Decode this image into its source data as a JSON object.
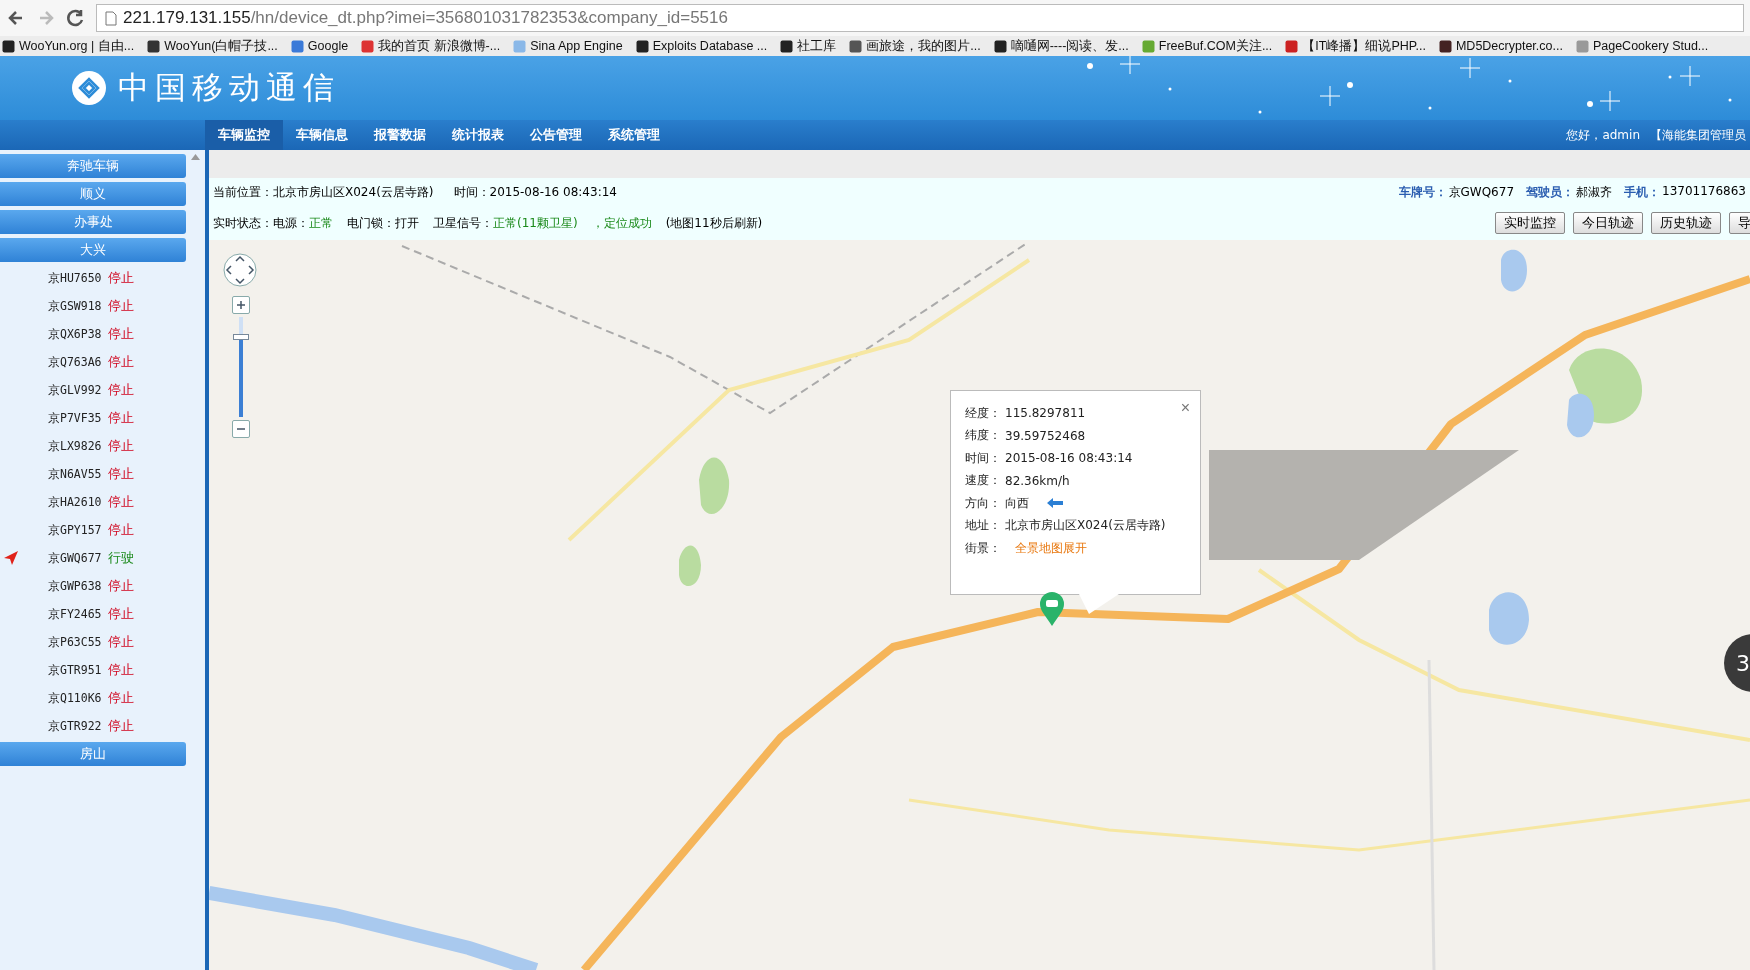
{
  "browser": {
    "url_host": "221.179.131.155",
    "url_path": "/hn/device_dt.php?imei=356801031782353&company_id=5516",
    "bookmarks": [
      {
        "label": "WooYun.org | 自由..."
      },
      {
        "label": "WooYun(白帽子技..."
      },
      {
        "label": "Google"
      },
      {
        "label": "我的首页 新浪微博-..."
      },
      {
        "label": "Sina App Engine"
      },
      {
        "label": "Exploits Database ..."
      },
      {
        "label": "社工库"
      },
      {
        "label": "画旅途，我的图片..."
      },
      {
        "label": "嘀嗵网----阅读、发..."
      },
      {
        "label": "FreeBuf.COM关注..."
      },
      {
        "label": "【IT峰播】细说PHP..."
      },
      {
        "label": "MD5Decrypter.co..."
      },
      {
        "label": "PageCookery Stud..."
      }
    ]
  },
  "header": {
    "logo_text": "中国移动通信",
    "greeting": "您好，admin",
    "role": "【海能集团管理员",
    "nav": [
      {
        "label": "车辆监控",
        "selected": true
      },
      {
        "label": "车辆信息",
        "selected": false
      },
      {
        "label": "报警数据",
        "selected": false
      },
      {
        "label": "统计报表",
        "selected": false
      },
      {
        "label": "公告管理",
        "selected": false
      },
      {
        "label": "系统管理",
        "selected": false
      }
    ]
  },
  "sidebar": {
    "groups": [
      {
        "label": "奔驰车辆"
      },
      {
        "label": "顺义"
      },
      {
        "label": "办事处"
      },
      {
        "label": "大兴",
        "vehicles": [
          {
            "plate": "京HU7650",
            "status": "停止",
            "kind": "stopped",
            "selected": false
          },
          {
            "plate": "京GSW918",
            "status": "停止",
            "kind": "stopped",
            "selected": false
          },
          {
            "plate": "京QX6P38",
            "status": "停止",
            "kind": "stopped",
            "selected": false
          },
          {
            "plate": "京Q763A6",
            "status": "停止",
            "kind": "stopped",
            "selected": false
          },
          {
            "plate": "京GLV992",
            "status": "停止",
            "kind": "stopped",
            "selected": false
          },
          {
            "plate": "京P7VF35",
            "status": "停止",
            "kind": "stopped",
            "selected": false
          },
          {
            "plate": "京LX9826",
            "status": "停止",
            "kind": "stopped",
            "selected": false
          },
          {
            "plate": "京N6AV55",
            "status": "停止",
            "kind": "stopped",
            "selected": false
          },
          {
            "plate": "京HA2610",
            "status": "停止",
            "kind": "stopped",
            "selected": false
          },
          {
            "plate": "京GPY157",
            "status": "停止",
            "kind": "stopped",
            "selected": false
          },
          {
            "plate": "京GWQ677",
            "status": "行驶",
            "kind": "moving",
            "selected": true
          },
          {
            "plate": "京GWP638",
            "status": "停止",
            "kind": "stopped",
            "selected": false
          },
          {
            "plate": "京FY2465",
            "status": "停止",
            "kind": "stopped",
            "selected": false
          },
          {
            "plate": "京P63C55",
            "status": "停止",
            "kind": "stopped",
            "selected": false
          },
          {
            "plate": "京GTR951",
            "status": "停止",
            "kind": "stopped",
            "selected": false
          },
          {
            "plate": "京Q110K6",
            "status": "停止",
            "kind": "stopped",
            "selected": false
          },
          {
            "plate": "京GTR922",
            "status": "停止",
            "kind": "stopped",
            "selected": false
          }
        ]
      },
      {
        "label": "房山"
      }
    ]
  },
  "info": {
    "row1": [
      "当前位置：北京市房山区X024(云居寺路)",
      "时间：2015-08-16 08:43:14"
    ],
    "vehicle_fields": [
      {
        "label": "车牌号：",
        "value": "京GWQ677"
      },
      {
        "label": "驾驶员：",
        "value": "郝淑齐"
      },
      {
        "label": "手机：",
        "value": "13701176863"
      }
    ],
    "row2": [
      {
        "text": "实时状态：电源：",
        "kind": "plain"
      },
      {
        "text": "正常",
        "kind": "ok"
      },
      {
        "text": "电门锁：打开",
        "kind": "plain"
      },
      {
        "text": "卫星信号：",
        "kind": "plain"
      },
      {
        "text": "正常(11颗卫星)",
        "kind": "ok"
      },
      {
        "text": "，定位成功",
        "kind": "ok"
      },
      {
        "text": "(地图11秒后刷新)",
        "kind": "plain"
      }
    ],
    "buttons": [
      "实时监控",
      "今日轨迹",
      "历史轨迹",
      "导"
    ]
  },
  "map": {
    "kind": "picture",
    "side_widget": "3",
    "zoom": {
      "level": 0.8
    },
    "popup": {
      "close": "×",
      "rows": [
        {
          "label": "经度：",
          "value": "115.8297811",
          "kind": "text"
        },
        {
          "label": "纬度：",
          "value": "39.59752468",
          "kind": "text"
        },
        {
          "label": "时间：",
          "value": "2015-08-16 08:43:14",
          "kind": "text"
        },
        {
          "label": "速度：",
          "value": "82.36km/h",
          "kind": "text"
        },
        {
          "label": "方向：",
          "value": "向西",
          "kind": "direction"
        },
        {
          "label": "地址：",
          "value": "北京市房山区X024(云居寺路)",
          "kind": "text"
        },
        {
          "label": "街景：",
          "value": "全景地图展开",
          "kind": "link"
        }
      ]
    }
  }
}
